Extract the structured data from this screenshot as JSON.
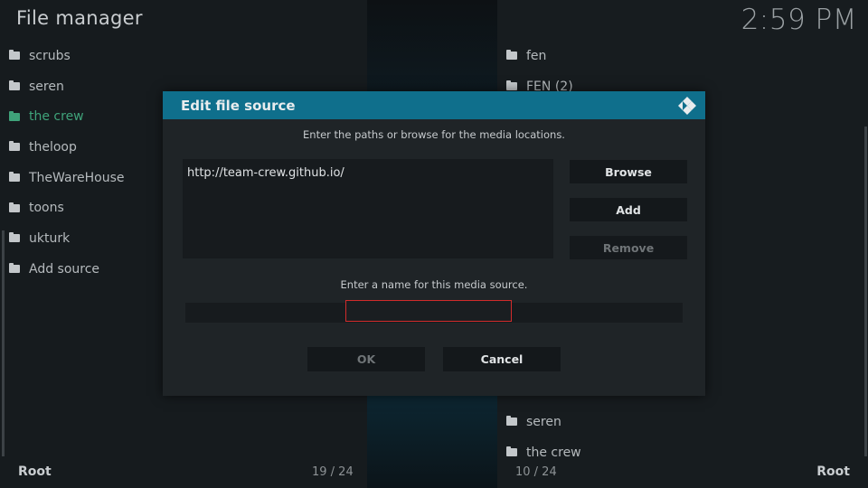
{
  "header": {
    "title": "File manager",
    "clock": "2:59 PM"
  },
  "left_pane": {
    "items": [
      {
        "label": "scrubs"
      },
      {
        "label": "seren"
      },
      {
        "label": "the crew"
      },
      {
        "label": "theloop"
      },
      {
        "label": "TheWareHouse"
      },
      {
        "label": "toons"
      },
      {
        "label": "ukturk"
      },
      {
        "label": "Add source"
      }
    ],
    "footer_label": "Root",
    "count": "19 / 24"
  },
  "right_pane": {
    "items_top": [
      {
        "label": "fen"
      },
      {
        "label": "FEN (2)"
      }
    ],
    "items_bottom": [
      {
        "label": "seren"
      },
      {
        "label": "the crew"
      }
    ],
    "footer_label": "Root",
    "count": "10 / 24"
  },
  "dialog": {
    "title": "Edit file source",
    "paths_instruction": "Enter the paths or browse for the media locations.",
    "paths": [
      "http://team-crew.github.io/"
    ],
    "browse_label": "Browse",
    "add_label": "Add",
    "remove_label": "Remove",
    "name_instruction": "Enter a name for this media source.",
    "name_value": "",
    "ok_label": "OK",
    "cancel_label": "Cancel"
  },
  "colors": {
    "accent": "#0f6f8c",
    "active_item": "#3fa37a",
    "focus_border": "#d12b2b"
  }
}
